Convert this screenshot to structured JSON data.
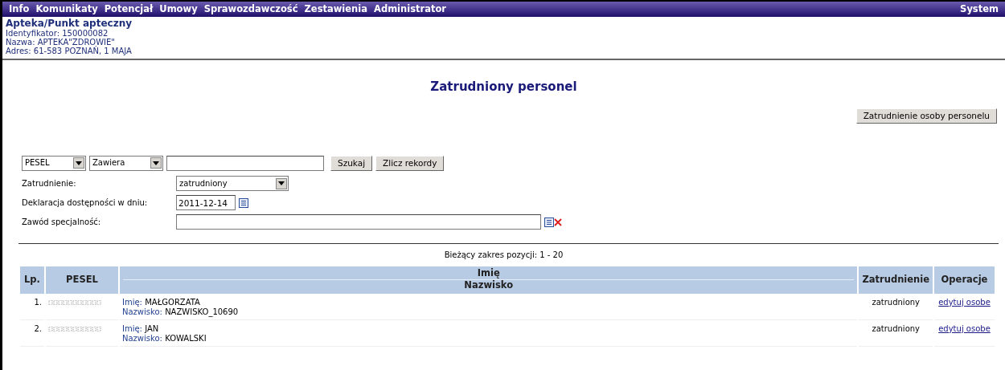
{
  "menu": {
    "items": [
      "Info",
      "Komunikaty",
      "Potencjał",
      "Umowy",
      "Sprawozdawczość",
      "Zestawienia",
      "Administrator"
    ],
    "right_item": "System"
  },
  "entity": {
    "title": "Apteka/Punkt apteczny",
    "lines": [
      "Identyfikator: 150000082",
      "Nazwa: APTEKA\"ZDROWIE\"",
      "Adres: 61-583 POZNAŃ, 1 MAJA"
    ]
  },
  "page_title": "Zatrudniony personel",
  "add_button": "Zatrudnienie osoby personelu",
  "search": {
    "field_select": "PESEL",
    "mode_select": "Zawiera",
    "search_button": "Szukaj",
    "count_button": "Zlicz rekordy"
  },
  "filters": [
    {
      "kind": "select",
      "label": "Zatrudnienie:",
      "value": "zatrudniony"
    },
    {
      "kind": "date",
      "label": "Deklaracja dostępności w dniu:",
      "value": "2011-12-14"
    },
    {
      "kind": "lookup",
      "label": "Zawód specjalność:"
    }
  ],
  "range_text": "Bieżący zakres pozycji: 1 - 20",
  "table": {
    "columns": [
      "Lp.",
      "PESEL",
      [
        "Imię",
        "Nazwisko"
      ],
      "Zatrudnienie",
      "Operacje"
    ],
    "rows": [
      {
        "lp": "1.",
        "first_label": "Imię:",
        "first": "MAŁGORZATA",
        "last_label": "Nazwisko:",
        "last": "NAZWISKO_10690",
        "status": "zatrudniony",
        "action": "edytuj osobe"
      },
      {
        "lp": "2.",
        "first_label": "Imię:",
        "first": "JAN",
        "last_label": "Nazwisko:",
        "last": "KOWALSKI",
        "status": "zatrudniony",
        "action": "edytuj osobe"
      }
    ]
  }
}
